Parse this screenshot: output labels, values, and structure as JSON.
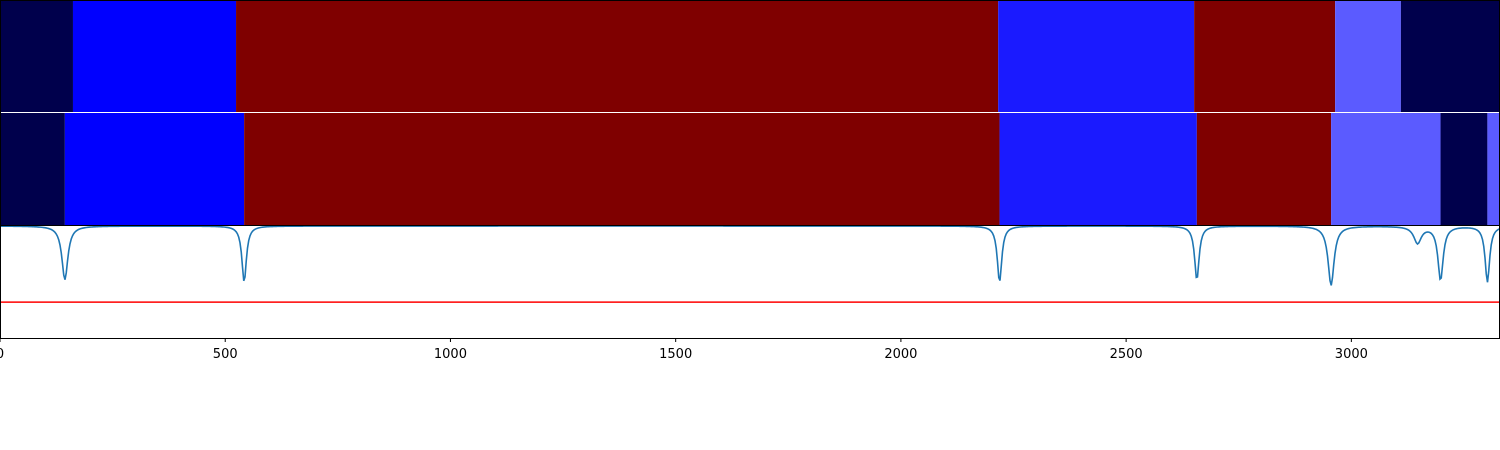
{
  "chart_data": {
    "type": "segmentation-timeline",
    "x_range": [
      0,
      3330
    ],
    "x_ticks": [
      0,
      500,
      1000,
      1500,
      2000,
      2500,
      3000
    ],
    "x_tick_labels": [
      "0",
      "500",
      "1000",
      "1500",
      "2000",
      "2500",
      "3000"
    ],
    "panels": [
      {
        "type": "heatmap",
        "segments": [
          {
            "start": 0,
            "end": 162,
            "color": "#00004c"
          },
          {
            "start": 162,
            "end": 524,
            "color": "#0000ff"
          },
          {
            "start": 524,
            "end": 2216,
            "color": "#7f0000"
          },
          {
            "start": 2216,
            "end": 2651,
            "color": "#1a1aff"
          },
          {
            "start": 2651,
            "end": 2964,
            "color": "#7f0000"
          },
          {
            "start": 2964,
            "end": 3110,
            "color": "#5b5bff"
          },
          {
            "start": 3110,
            "end": 3330,
            "color": "#00004c"
          }
        ]
      },
      {
        "type": "heatmap",
        "segments": [
          {
            "start": 0,
            "end": 144,
            "color": "#00004c"
          },
          {
            "start": 144,
            "end": 542,
            "color": "#0000ff"
          },
          {
            "start": 542,
            "end": 2219,
            "color": "#7f0000"
          },
          {
            "start": 2219,
            "end": 2657,
            "color": "#1a1aff"
          },
          {
            "start": 2657,
            "end": 2955,
            "color": "#7f0000"
          },
          {
            "start": 2955,
            "end": 3198,
            "color": "#5b5bff"
          },
          {
            "start": 3198,
            "end": 3302,
            "color": "#00004c"
          },
          {
            "start": 3302,
            "end": 3330,
            "color": "#5b5bff"
          }
        ]
      },
      {
        "type": "line",
        "ylim": [
          0,
          1
        ],
        "line_color": "#1f77b4",
        "threshold": {
          "y": 0.32,
          "color": "#ff0000"
        },
        "baseline": 1.0,
        "dips": [
          {
            "x": 144,
            "y": 0.52,
            "width": 8
          },
          {
            "x": 542,
            "y": 0.5,
            "width": 6
          },
          {
            "x": 2219,
            "y": 0.5,
            "width": 6
          },
          {
            "x": 2657,
            "y": 0.52,
            "width": 6
          },
          {
            "x": 2955,
            "y": 0.47,
            "width": 8
          },
          {
            "x": 3147,
            "y": 0.85,
            "width": 10
          },
          {
            "x": 3198,
            "y": 0.52,
            "width": 7
          },
          {
            "x": 3302,
            "y": 0.5,
            "width": 6
          }
        ]
      }
    ]
  }
}
